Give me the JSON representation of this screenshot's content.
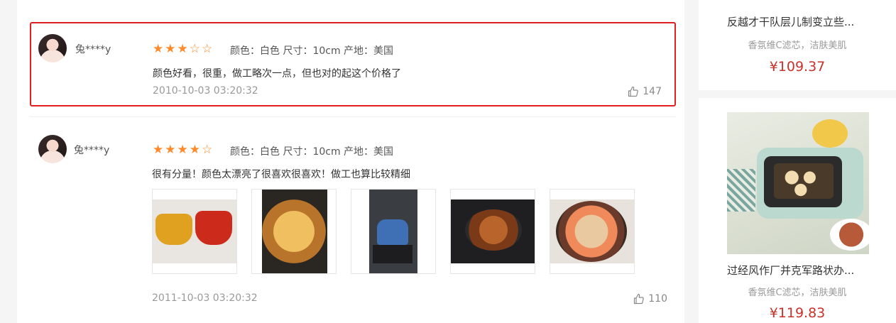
{
  "reviews": [
    {
      "username": "兔****y",
      "rating": 3,
      "rating_max": 5,
      "specs": "颜色：白色 尺寸：10cm 产地：美国",
      "content": "颜色好看，很重，做工略次一点，但也对的起这个价格了",
      "time": "2010-10-03 03:20:32",
      "likes": "147"
    },
    {
      "username": "兔****y",
      "rating": 4,
      "rating_max": 5,
      "specs": "颜色：白色 尺寸：10cm 产地：美国",
      "content": "很有分量！颜色太漂亮了很喜欢很喜欢！做工也算比较精细",
      "photos": [
        "cast-iron-pots",
        "baked-dish",
        "blue-pot-on-stove",
        "braised-pot",
        "noodle-bowl"
      ],
      "time": "2011-10-03 03:20:32",
      "likes": "110"
    }
  ],
  "sidebar": {
    "products": [
      {
        "title": "反越才干队层儿制变立些...",
        "desc": "香氛维C滤芯，洁肤美肌",
        "price": "¥109.37"
      },
      {
        "title": "过经风作厂并克军路状办...",
        "desc": "香氛维C滤芯，洁肤美肌",
        "price": "¥119.83",
        "image": "electric-grill-pan"
      }
    ]
  },
  "colors": {
    "accent_star": "#ff8a2b",
    "price": "#c7322b",
    "highlight_border": "#e02020"
  }
}
